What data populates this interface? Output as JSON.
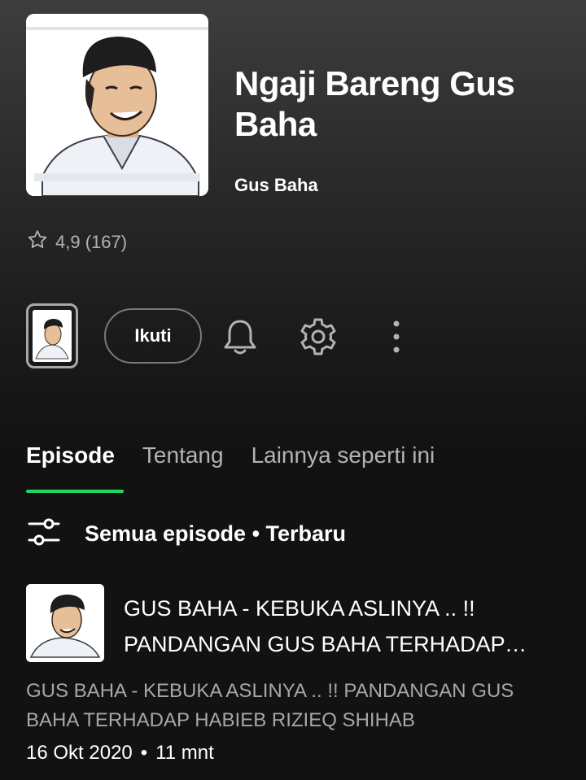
{
  "podcast": {
    "title": "Ngaji Bareng Gus Baha",
    "author": "Gus Baha",
    "rating_text": "4,9 (167)"
  },
  "actions": {
    "follow_label": "Ikuti",
    "icons": [
      "bell-icon",
      "gear-icon",
      "more-vertical-icon"
    ]
  },
  "tabs": [
    {
      "label": "Episode",
      "active": true
    },
    {
      "label": "Tentang",
      "active": false
    },
    {
      "label": "Lainnya seperti ini",
      "active": false
    }
  ],
  "filter": {
    "label": "Semua episode • Terbaru",
    "icon": "sliders-icon"
  },
  "episodes": [
    {
      "title": "GUS BAHA - KEBUKA ASLINYA .. !! PANDANGAN GUS BAHA TERHADAP HABIEB RIZIEQ SHIHAB",
      "description": "GUS BAHA - KEBUKA ASLINYA .. !! PANDANGAN GUS BAHA TERHADAP HABIEB RIZIEQ SHIHAB",
      "date": "16 Okt 2020",
      "separator": "•",
      "duration": "11 mnt"
    }
  ],
  "colors": {
    "accent": "#1ed760",
    "background": "#121212",
    "secondary_text": "#b3b3b3"
  }
}
